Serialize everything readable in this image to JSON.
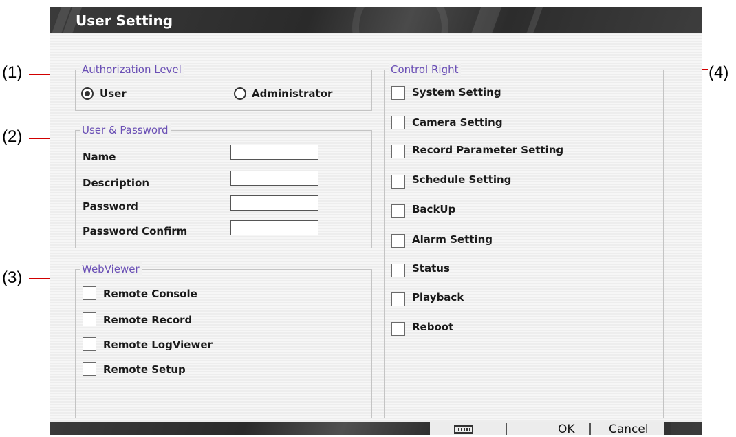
{
  "window": {
    "title": "User Setting"
  },
  "annotations": [
    "(1)",
    "(2)",
    "(3)",
    "(4)"
  ],
  "authorization": {
    "legend": "Authorization Level",
    "options": [
      {
        "label": "User",
        "selected": true
      },
      {
        "label": "Administrator",
        "selected": false
      }
    ]
  },
  "user_password": {
    "legend": "User & Password",
    "fields": [
      {
        "label": "Name",
        "value": ""
      },
      {
        "label": "Description",
        "value": ""
      },
      {
        "label": "Password",
        "value": ""
      },
      {
        "label": "Password Confirm",
        "value": ""
      }
    ]
  },
  "webviewer": {
    "legend": "WebViewer",
    "items": [
      {
        "label": "Remote Console",
        "checked": false
      },
      {
        "label": "Remote Record",
        "checked": false
      },
      {
        "label": "Remote LogViewer",
        "checked": false
      },
      {
        "label": "Remote Setup",
        "checked": false
      }
    ]
  },
  "control_right": {
    "legend": "Control Right",
    "items": [
      {
        "label": "System Setting",
        "checked": false
      },
      {
        "label": "Camera Setting",
        "checked": false
      },
      {
        "label": "Record Parameter Setting",
        "checked": false
      },
      {
        "label": "Schedule Setting",
        "checked": false
      },
      {
        "label": "BackUp",
        "checked": false
      },
      {
        "label": "Alarm Setting",
        "checked": false
      },
      {
        "label": "Status",
        "checked": false
      },
      {
        "label": "Playback",
        "checked": false
      },
      {
        "label": "Reboot",
        "checked": false
      }
    ]
  },
  "footer": {
    "keyboard_icon": "keyboard-icon",
    "ok_label": "OK",
    "cancel_label": "Cancel"
  },
  "colors": {
    "legend": "#6a4fb5",
    "annotation_line": "#d10000",
    "title_bar": "#2e2e2e"
  }
}
